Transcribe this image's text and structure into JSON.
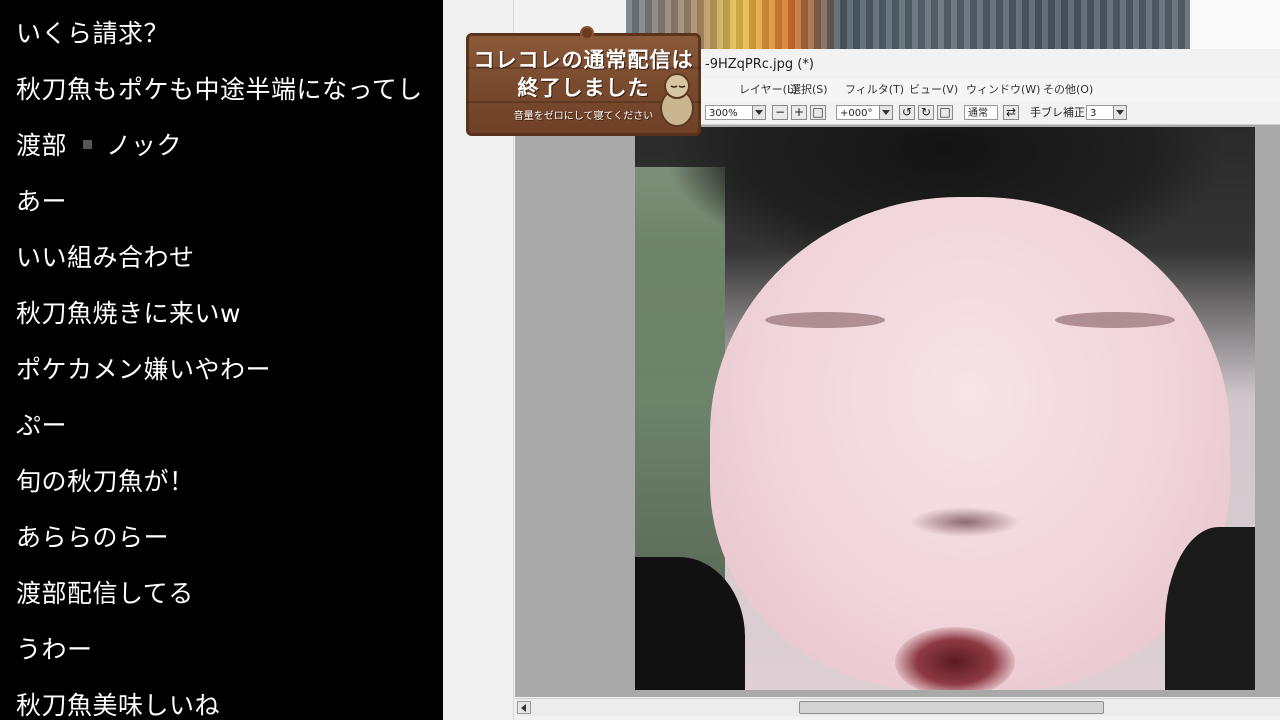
{
  "comments": [
    "いくら請求？",
    "秋刀魚もポケも中途半端になってし",
    "渡部 ■ ノック",
    "あー",
    "いい組み合わせ",
    "秋刀魚焼きに来いw",
    "ポケカメン嫌いやわー",
    "ぷー",
    "旬の秋刀魚が！",
    "あららのらー",
    "渡部配信してる",
    "うわー",
    "秋刀魚美味しいね"
  ],
  "comment_parts": {
    "knock_prefix": "渡部",
    "knock_suffix": "ノック"
  },
  "sign": {
    "line1": "コレコレの通常配信は",
    "line2": "終了しました",
    "subtitle": "音量をゼロにして寝てください"
  },
  "window": {
    "title": "-9HZqPRc.jpg (*)"
  },
  "menu": [
    "レイヤー(L)",
    "選択(S)",
    "フィルタ(T)",
    "ビュー(V)",
    "ウィンドウ(W)",
    "その他(O)"
  ],
  "toolbar": {
    "zoom": "300%",
    "angle": "+000°",
    "blend": "通常",
    "stabilizer_label": "手ブレ補正",
    "stabilizer_value": "3"
  },
  "colors": {
    "comment_bg": "#000000",
    "comment_text": "#ffffff",
    "sign_wood": "#7a4a2e",
    "app_bg": "#f2f2f2",
    "canvas_bg": "#a9a9a9"
  }
}
